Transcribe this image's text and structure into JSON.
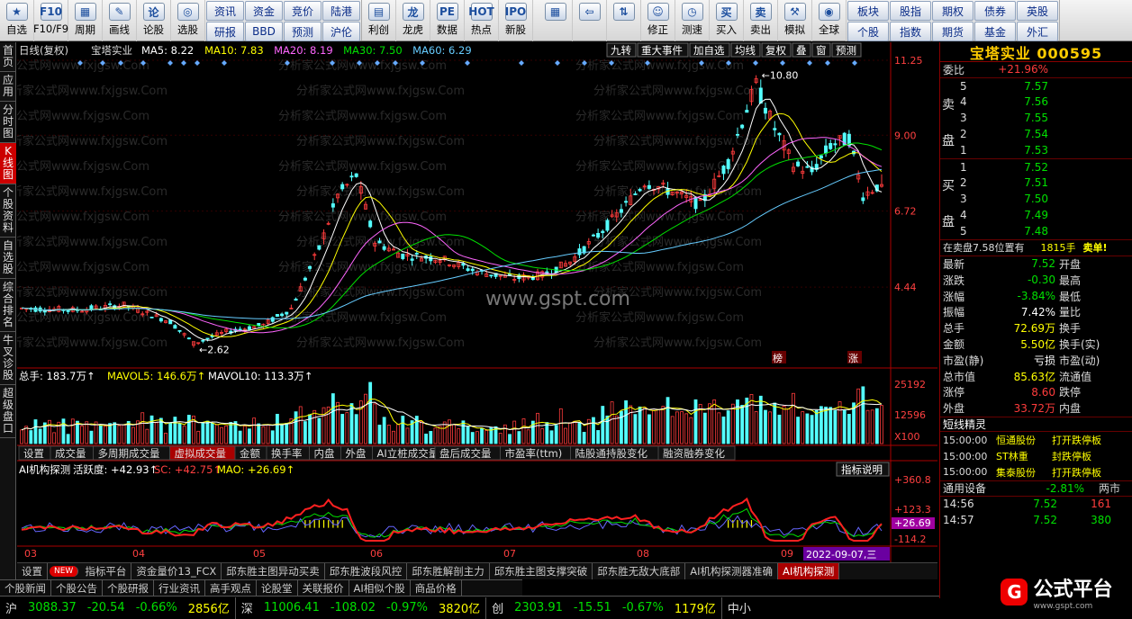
{
  "toolbar": {
    "left_buttons": [
      {
        "label": "自选",
        "icon": "star-icon",
        "glyph": "★"
      },
      {
        "label": "F10/F9",
        "icon": "f10-icon",
        "glyph": "F10"
      },
      {
        "label": "周期",
        "icon": "calendar-icon",
        "glyph": "▦"
      },
      {
        "label": "画线",
        "icon": "pen-icon",
        "glyph": "✎"
      },
      {
        "label": "论股",
        "icon": "forum-icon",
        "glyph": "论"
      },
      {
        "label": "选股",
        "icon": "select-stock-icon",
        "glyph": "◎"
      }
    ],
    "grid1": [
      "资讯",
      "资金",
      "竞价",
      "陆港",
      "研报",
      "BBD",
      "预测",
      "沪伦"
    ],
    "mid_buttons": [
      {
        "label": "利创",
        "icon": "chart-icon",
        "glyph": "▤"
      },
      {
        "label": "龙虎",
        "icon": "dragon-tiger-icon",
        "glyph": "龙"
      },
      {
        "label": "数据",
        "icon": "pe-icon",
        "glyph": "PE"
      },
      {
        "label": "热点",
        "icon": "hot-icon",
        "glyph": "HOT"
      },
      {
        "label": "新股",
        "icon": "ipo-icon",
        "glyph": "IPO"
      }
    ],
    "right_buttons": [
      {
        "label": "",
        "icon": "layout-icon",
        "glyph": "▦"
      },
      {
        "label": "",
        "icon": "back-arrow-icon",
        "glyph": "⇦"
      },
      {
        "label": "",
        "icon": "up-down-icon",
        "glyph": "⇅"
      },
      {
        "label": "修正",
        "icon": "smile-icon",
        "glyph": "☺"
      },
      {
        "label": "测速",
        "icon": "clock-icon",
        "glyph": "◷"
      },
      {
        "label": "买入",
        "icon": "buy-icon",
        "glyph": "买"
      },
      {
        "label": "卖出",
        "icon": "sell-icon",
        "glyph": "卖"
      },
      {
        "label": "模拟",
        "icon": "hammer-icon",
        "glyph": "⚒"
      },
      {
        "label": "全球",
        "icon": "globe-icon",
        "glyph": "◉"
      }
    ],
    "grid2": [
      "板块",
      "股指",
      "期权",
      "债券",
      "英股",
      "个股",
      "指数",
      "期货",
      "基金",
      "外汇"
    ]
  },
  "left_tabs": [
    "首页",
    "应用",
    "分时图",
    "K线图",
    "个股资料",
    "自选股",
    "综合排名",
    "牛叉诊股",
    "超级盘口"
  ],
  "chart": {
    "header": {
      "period": "日线(复权)",
      "name": "宝塔实业",
      "ma5": "MA5: 8.22",
      "ma10": "MA10: 7.83",
      "ma20": "MA20: 8.19",
      "ma30": "MA30: 7.50",
      "ma60": "MA60: 6.29"
    },
    "top_buttons": [
      "九转",
      "重大事件",
      "加自选",
      "均线",
      "复权",
      "叠",
      "窗",
      "预测"
    ],
    "price_axis": [
      "11.25",
      "9.00",
      "6.72",
      "4.44"
    ],
    "high_label": "10.80",
    "low_label": "2.62",
    "watermark": "www.gspt.com",
    "bg_watermark": "分析家公式网www.fxjgsw.Com",
    "badges": [
      "榜",
      "涨"
    ],
    "vol_header": {
      "total": "总手: 183.7万↑",
      "mavol5": "MAVOL5: 146.6万↑",
      "mavol10": "MAVOL10: 113.3万↑"
    },
    "vol_axis": [
      "25192",
      "12596",
      "X100"
    ],
    "ind_tabs": [
      "设置",
      "成交量",
      "多周期成交量",
      "虚拟成交量",
      "金额",
      "换手率",
      "内盘",
      "外盘",
      "AI立桩成交量",
      "盘后成交量",
      "市盈率(ttm)",
      "陆股通持股变化",
      "融资融券变化"
    ],
    "ind_active": "虚拟成交量",
    "ai_header": {
      "name": "AI机构探测",
      "active": "活跃度: +42.93↑",
      "sc": "SC: +42.75↑",
      "mao": "MAO: +26.69↑"
    },
    "ind_button": "指标说明",
    "ai_axis": [
      "+360.8",
      "+123.3",
      "+26.69",
      "-114.2"
    ],
    "months": [
      "03",
      "04",
      "05",
      "06",
      "07",
      "08",
      "09"
    ],
    "date_box": "2022-09-07,三"
  },
  "chart_data": {
    "type": "candlestick",
    "title": "宝塔实业 000595 日线(复权)",
    "ylim": [
      2.2,
      11.25
    ],
    "high": 10.8,
    "low": 2.62,
    "last_close": 7.52,
    "ma_values": {
      "MA5": 8.22,
      "MA10": 7.83,
      "MA20": 8.19,
      "MA30": 7.5,
      "MA60": 6.29
    },
    "volume_total_wan": 183.7,
    "mavol5_wan": 146.6,
    "mavol10_wan": 113.3,
    "ai_indicator": {
      "活跃度": 42.93,
      "SC": 42.75,
      "MAO": 26.69
    }
  },
  "right_panel": {
    "title": "宝塔实业 000595",
    "weibi": {
      "label": "委比",
      "value": "+21.96%"
    },
    "sell": [
      {
        "n": "5",
        "p": "7.57"
      },
      {
        "n": "4",
        "p": "7.56"
      },
      {
        "n": "3",
        "p": "7.55"
      },
      {
        "n": "2",
        "p": "7.54"
      },
      {
        "n": "1",
        "p": "7.53"
      }
    ],
    "sell_label": "卖盘",
    "buy": [
      {
        "n": "1",
        "p": "7.52"
      },
      {
        "n": "2",
        "p": "7.51"
      },
      {
        "n": "3",
        "p": "7.50"
      },
      {
        "n": "4",
        "p": "7.49"
      },
      {
        "n": "5",
        "p": "7.48"
      }
    ],
    "buy_label": "买盘",
    "note": {
      "text": "在卖盘7.58位置有",
      "qty": "1815手",
      "tag": "卖单!"
    },
    "stats": [
      {
        "k1": "最新",
        "v1": "7.52",
        "k2": "开盘",
        "c": "grn"
      },
      {
        "k1": "涨跌",
        "v1": "-0.30",
        "k2": "最高",
        "c": "grn"
      },
      {
        "k1": "涨幅",
        "v1": "-3.84%",
        "k2": "最低",
        "c": "grn"
      },
      {
        "k1": "振幅",
        "v1": "7.42%",
        "k2": "量比",
        "c": "wht"
      },
      {
        "k1": "总手",
        "v1": "72.69万",
        "k2": "换手",
        "c": "yel"
      },
      {
        "k1": "金额",
        "v1": "5.50亿",
        "k2": "换手(实)",
        "c": "yel"
      },
      {
        "k1": "市盈(静)",
        "v1": "亏损",
        "k2": "市盈(动)",
        "c": "wht"
      },
      {
        "k1": "总市值",
        "v1": "85.63亿",
        "k2": "流通值",
        "c": "yel"
      },
      {
        "k1": "涨停",
        "v1": "8.60",
        "k2": "跌停",
        "c": "red"
      },
      {
        "k1": "外盘",
        "v1": "33.72万",
        "k2": "内盘",
        "c": "red"
      }
    ],
    "duanxian_title": "短线精灵",
    "duanxian": [
      {
        "t": "15:00:00",
        "s": "恒通股份",
        "e": "打开跌停板"
      },
      {
        "t": "15:00:00",
        "s": "ST林重",
        "e": "封跌停板"
      },
      {
        "t": "15:00:00",
        "s": "集泰股份",
        "e": "打开跌停板"
      }
    ],
    "sector": {
      "name": "通用设备",
      "pct": "-2.81%",
      "extra": "两市"
    },
    "ticks": [
      {
        "t": "14:56",
        "p": "7.52",
        "v": "161"
      },
      {
        "t": "14:57",
        "p": "7.52",
        "v": "380"
      }
    ]
  },
  "bottom_formula_tabs": [
    "设置",
    "NEW",
    "指标平台",
    "资金量价13_FCX",
    "邱东胜主图异动买卖",
    "邱东胜波段风控",
    "邱东胜解剖主力",
    "邱东胜主图支撑突破",
    "邱东胜无敌大底部",
    "AI机构探测器准确",
    "AI机构探测"
  ],
  "bottom_nav_tabs": [
    "个股新闻",
    "个股公告",
    "个股研报",
    "行业资讯",
    "高手观点",
    "论股堂",
    "关联报价",
    "AI相似个股",
    "商品价格"
  ],
  "index_bar": [
    {
      "n": "沪",
      "v": "3088.37",
      "c": "-20.54",
      "p": "-0.66%",
      "a": "2856亿"
    },
    {
      "n": "深",
      "v": "11006.41",
      "c": "-108.02",
      "p": "-0.97%",
      "a": "3820亿"
    },
    {
      "n": "创",
      "v": "2303.91",
      "c": "-15.51",
      "p": "-0.67%",
      "a": "1179亿"
    }
  ],
  "index_tail": "中小",
  "logo": {
    "text": "公式平台",
    "sub": "www.gspt.com"
  },
  "colors": {
    "up": "#ff3c3c",
    "down": "#54ffff",
    "ma5": "#ffffff",
    "ma10": "#ffff00",
    "ma20": "#ff66ff",
    "ma30": "#00e000",
    "ma60": "#66ccff"
  }
}
